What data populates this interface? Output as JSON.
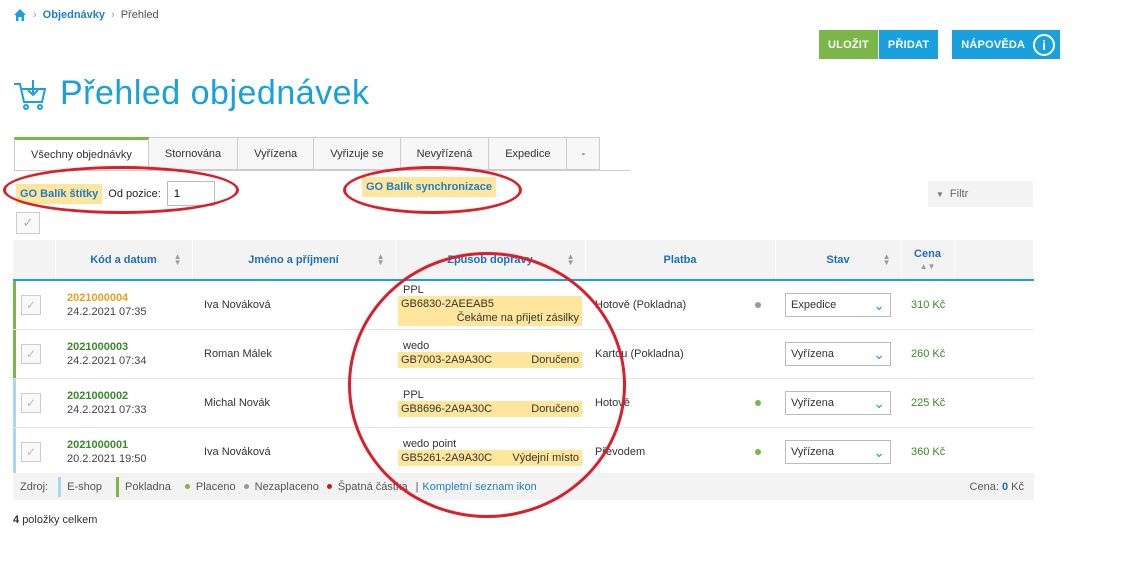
{
  "breadcrumb": {
    "section": "Objednávky",
    "current": "Přehled"
  },
  "toolbar": {
    "save": "ULOŽIT",
    "add": "PŘIDAT",
    "help": "NÁPOVĚDA"
  },
  "page_title": "Přehled objednávek",
  "tabs": [
    "Všechny objednávky",
    "Stornována",
    "Vyřízena",
    "Vyřizuje se",
    "Nevyřízená",
    "Expedice",
    "-"
  ],
  "gobalik": {
    "labels_btn": "GO Balík štítky",
    "from_pos_label": "Od pozice:",
    "from_pos_value": "1",
    "sync_btn": "GO Balík synchronizace"
  },
  "filter_label": "Filtr",
  "table": {
    "headers": [
      "Kód a datum",
      "Jméno a příjmení",
      "Způsob dopravy",
      "Platba",
      "Stav",
      "Cena"
    ],
    "rows": [
      {
        "code": "2021000004",
        "date": "24.2.2021 07:35",
        "name": "Iva Nováková",
        "carrier": "PPL",
        "tracking": "GB6830-2AEEAB5",
        "ship_status": "Čekáme na přijetí zásilky",
        "payment": "Hotově (Pokladna)",
        "state": "Expedice",
        "price": "310 Kč"
      },
      {
        "code": "2021000003",
        "date": "24.2.2021 07:34",
        "name": "Roman Málek",
        "carrier": "wedo",
        "tracking": "GB7003-2A9A30C",
        "ship_status": "Doručeno",
        "payment": "Kartou (Pokladna)",
        "state": "Vyřízena",
        "price": "260 Kč"
      },
      {
        "code": "2021000002",
        "date": "24.2.2021 07:33",
        "name": "Michal Novák",
        "carrier": "PPL",
        "tracking": "GB8696-2A9A30C",
        "ship_status": "Doručeno",
        "payment": "Hotově",
        "state": "Vyřízena",
        "price": "225 Kč"
      },
      {
        "code": "2021000001",
        "date": "20.2.2021 19:50",
        "name": "Iva Nováková",
        "carrier": "wedo point",
        "tracking": "GB5261-2A9A30C",
        "ship_status": "Výdejní místo",
        "payment": "Převodem",
        "state": "Vyřízena",
        "price": "360 Kč"
      }
    ]
  },
  "footer": {
    "source_label": "Zdroj:",
    "eshop": "E-shop",
    "pokladna": "Pokladna",
    "paid": "Placeno",
    "unpaid": "Nezaplaceno",
    "bad": "Špatná částka",
    "sep": "|",
    "icons_link": "Kompletní seznam ikon",
    "price_label": "Cena:",
    "price_value": "0",
    "currency": "Kč"
  },
  "count_num": "4",
  "count_text": "položky celkem",
  "colors": {
    "accent_blue": "#1aa0dc",
    "accent_green": "#7ab648",
    "highlight": "#ffe69c",
    "annotation_red": "#d9202a"
  }
}
